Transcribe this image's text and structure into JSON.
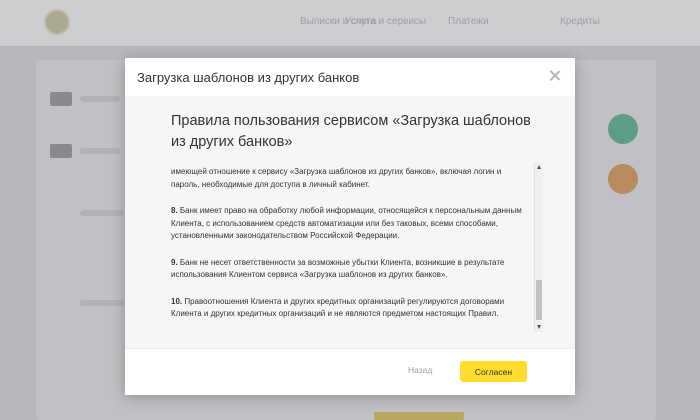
{
  "background": {
    "nav": [
      "Услуги и сервисы",
      "Платежи",
      "Кредиты",
      "Выписки и счета"
    ]
  },
  "modal": {
    "title": "Загрузка шаблонов из других банков",
    "rules_title": "Правила пользования сервисом «Загрузка шаблонов из других банков»",
    "paragraphs": [
      {
        "num": "",
        "text": "имеющей отношение к сервису «Загрузка шаблонов из других банков», включая логин и пароль, необходимые для доступа в личный кабинет."
      },
      {
        "num": "8.",
        "text": "Банк имеет право на обработку любой информации, относящейся к персональным данным Клиента, с использованием средств автоматизации или без таковых, всеми способами, установленными законодательством Российской Федерации."
      },
      {
        "num": "9.",
        "text": "Банк не несет ответственности за возможные убытки Клиента, возникшие в результате использования Клиентом сервиса «Загрузка шаблонов из других банков»."
      },
      {
        "num": "10.",
        "text": "Правоотношения Клиента и других кредитных организаций регулируются договорами Клиента и других кредитных организаций и не являются предметом настоящих Правил."
      }
    ],
    "back_label": "Назад",
    "agree_label": "Согласен"
  },
  "colors": {
    "accent": "#ffdd2d",
    "text": "#333333",
    "muted": "#9ea0a3"
  }
}
